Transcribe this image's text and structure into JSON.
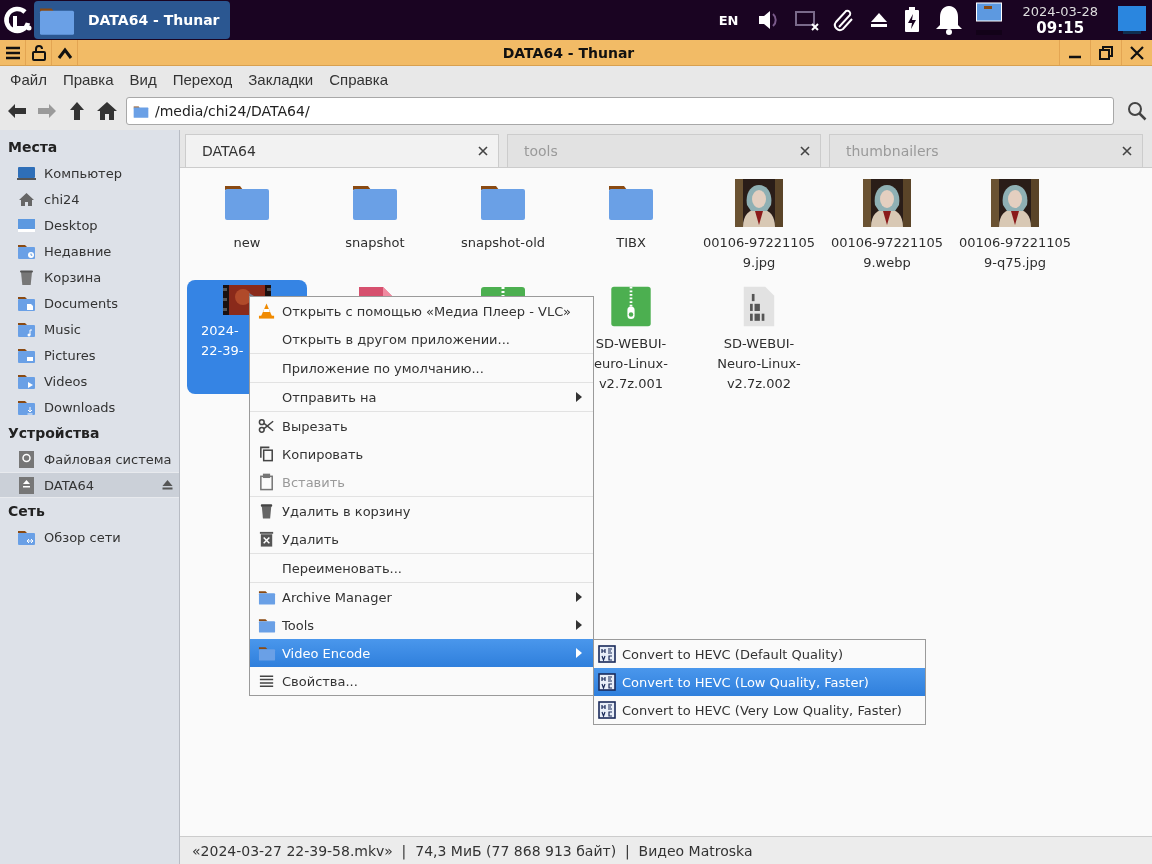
{
  "top_panel": {
    "taskbar": [
      {
        "title": "DATA64 - Thunar",
        "selected": true
      }
    ],
    "keyboard_layout": "EN",
    "date": "2024-03-28",
    "time": "09:15"
  },
  "window": {
    "title": "DATA64 - Thunar"
  },
  "menu_bar": [
    "Файл",
    "Правка",
    "Вид",
    "Переход",
    "Закладки",
    "Справка"
  ],
  "nav_buttons": [
    {
      "disabled": false
    },
    {
      "disabled": true
    },
    {
      "disabled": false
    },
    {
      "disabled": false
    }
  ],
  "location": {
    "value": "/media/chi24/DATA64/"
  },
  "sidebar": {
    "sections": [
      {
        "title": "Места",
        "items": [
          {
            "label": "Компьютер",
            "selected": false,
            "ejectable": false
          },
          {
            "label": "chi24",
            "selected": false,
            "ejectable": false
          },
          {
            "label": "Desktop",
            "selected": false,
            "ejectable": false
          },
          {
            "label": "Недавние",
            "selected": false,
            "ejectable": false
          },
          {
            "label": "Корзина",
            "selected": false,
            "ejectable": false
          },
          {
            "label": "Documents",
            "selected": false,
            "ejectable": false
          },
          {
            "label": "Music",
            "selected": false,
            "ejectable": false
          },
          {
            "label": "Pictures",
            "selected": false,
            "ejectable": false
          },
          {
            "label": "Videos",
            "selected": false,
            "ejectable": false
          },
          {
            "label": "Downloads",
            "selected": false,
            "ejectable": false
          }
        ]
      },
      {
        "title": "Устройства",
        "items": [
          {
            "label": "Файловая система",
            "selected": false,
            "ejectable": false
          },
          {
            "label": "DATA64",
            "selected": true,
            "ejectable": true
          }
        ]
      },
      {
        "title": "Сеть",
        "items": [
          {
            "label": "Обзор сети",
            "selected": false,
            "ejectable": false
          }
        ]
      }
    ]
  },
  "tabs": [
    {
      "label": "DATA64",
      "selected": true
    },
    {
      "label": "tools",
      "selected": false
    },
    {
      "label": "thumbnailers",
      "selected": false
    }
  ],
  "files": [
    {
      "kind": "folder",
      "lines": [
        "new"
      ],
      "selected": false,
      "cut": false
    },
    {
      "kind": "folder",
      "lines": [
        "snapshot"
      ],
      "selected": false,
      "cut": false
    },
    {
      "kind": "folder",
      "lines": [
        "snapshot-old"
      ],
      "selected": false,
      "cut": false
    },
    {
      "kind": "folder",
      "lines": [
        "TIBX"
      ],
      "selected": false,
      "cut": false
    },
    {
      "lines": [
        "00106-97221105",
        "9.jpg"
      ],
      "selected": false,
      "cut": false
    },
    {
      "lines": [
        "00106-97221105",
        "9.webp"
      ],
      "selected": false,
      "cut": false
    },
    {
      "lines": [
        "00106-97221105",
        "9-q75.jpg"
      ],
      "selected": false,
      "cut": false
    },
    {
      "kind": "video",
      "lines": [
        "2024-",
        "22-39-"
      ],
      "selected": true,
      "cut": true
    },
    {
      "kind": "document",
      "selected": false
    },
    {
      "kind": "archive",
      "selected": false
    },
    {
      "kind": "archive",
      "lines": [
        "SD-WEBUI-",
        "euro-Linux-",
        "v2.7z.001"
      ],
      "selected": false,
      "cut": false
    },
    {
      "kind": "binary",
      "lines": [
        "SD-WEBUI-",
        "Neuro-Linux-",
        "v2.7z.002"
      ],
      "selected": false,
      "cut": false
    }
  ],
  "context_menu": {
    "items": [
      {
        "kind": "item",
        "label": "Открыть с помощью «Медиа Плеер - VLC»",
        "disabled": false,
        "submenu": false,
        "selected": false
      },
      {
        "kind": "item",
        "label": "Открыть в другом приложении...",
        "disabled": false,
        "submenu": false,
        "selected": false
      },
      {
        "kind": "separator"
      },
      {
        "kind": "item",
        "label": "Приложение по умолчанию...",
        "disabled": false,
        "submenu": false,
        "selected": false
      },
      {
        "kind": "separator"
      },
      {
        "kind": "item",
        "label": "Отправить на",
        "disabled": false,
        "submenu": true,
        "selected": false
      },
      {
        "kind": "separator"
      },
      {
        "kind": "item",
        "label": "Вырезать",
        "disabled": false,
        "submenu": false,
        "selected": false
      },
      {
        "kind": "item",
        "label": "Копировать",
        "disabled": false,
        "submenu": false,
        "selected": false
      },
      {
        "kind": "item",
        "label": "Вставить",
        "disabled": true,
        "submenu": false,
        "selected": false
      },
      {
        "kind": "separator"
      },
      {
        "kind": "item",
        "label": "Удалить в корзину",
        "disabled": false,
        "submenu": false,
        "selected": false
      },
      {
        "kind": "item",
        "label": "Удалить",
        "disabled": false,
        "submenu": false,
        "selected": false
      },
      {
        "kind": "separator"
      },
      {
        "kind": "item",
        "label": "Переименовать...",
        "disabled": false,
        "submenu": false,
        "selected": false
      },
      {
        "kind": "separator"
      },
      {
        "kind": "item",
        "label": "Archive Manager",
        "disabled": false,
        "submenu": true,
        "selected": false
      },
      {
        "kind": "item",
        "label": "Tools",
        "disabled": false,
        "submenu": true,
        "selected": false
      },
      {
        "kind": "item",
        "label": "Video Encode",
        "disabled": false,
        "submenu": true,
        "selected": true
      },
      {
        "kind": "item",
        "label": "Свойства...",
        "disabled": false,
        "submenu": false,
        "selected": false
      }
    ]
  },
  "submenu": {
    "items": [
      {
        "label": "Convert to HEVC (Default Quality)",
        "selected": false
      },
      {
        "label": "Convert to HEVC (Low Quality, Faster)",
        "selected": true
      },
      {
        "label": "Convert to HEVC (Very Low Quality, Faster)",
        "selected": false
      }
    ]
  },
  "status_bar": "«2024-03-27 22-39-58.mkv»  |  74,3 МиБ (77 868 913 байт)  |  Видео Matroska"
}
